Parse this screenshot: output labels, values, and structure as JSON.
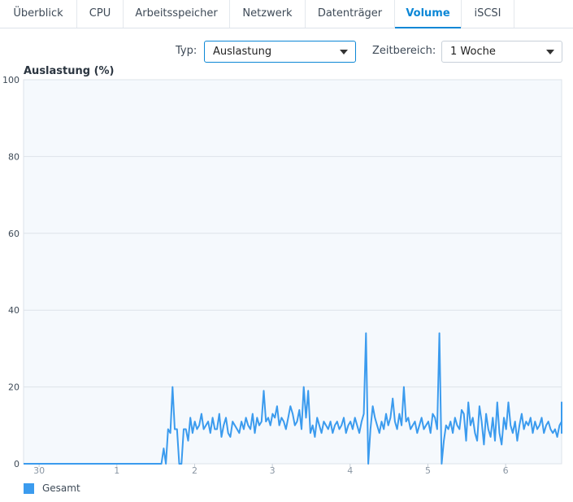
{
  "tabs": [
    {
      "label": "Überblick",
      "active": false
    },
    {
      "label": "CPU",
      "active": false
    },
    {
      "label": "Arbeitsspeicher",
      "active": false
    },
    {
      "label": "Netzwerk",
      "active": false
    },
    {
      "label": "Datenträger",
      "active": false
    },
    {
      "label": "Volume",
      "active": true
    },
    {
      "label": "iSCSI",
      "active": false
    }
  ],
  "filters": {
    "type_label": "Typ:",
    "type_value": "Auslastung",
    "range_label": "Zeitbereich:",
    "range_value": "1 Woche"
  },
  "colors": {
    "accent": "#0c87d6",
    "series": "#3b9bee",
    "plot_bg": "#f5f9fd"
  },
  "chart_data": {
    "type": "line",
    "title": "Auslastung (%)",
    "ylim": [
      0,
      100
    ],
    "yticks": [
      0,
      20,
      40,
      60,
      80,
      100
    ],
    "xlim": [
      29.8,
      6.72
    ],
    "xticks": [
      "30",
      "1",
      "2",
      "3",
      "4",
      "5",
      "6"
    ],
    "grid": true,
    "legend": "bottom-left",
    "series": [
      {
        "name": "Gesamt",
        "x_start": 29.8,
        "x_step": 0.0286,
        "values": [
          0,
          0,
          0,
          0,
          0,
          0,
          0,
          0,
          0,
          0,
          0,
          0,
          0,
          0,
          0,
          0,
          0,
          0,
          0,
          0,
          0,
          0,
          0,
          0,
          0,
          0,
          0,
          0,
          0,
          0,
          0,
          0,
          0,
          0,
          0,
          0,
          0,
          0,
          0,
          0,
          0,
          0,
          0,
          0,
          0,
          0,
          0,
          0,
          0,
          0,
          0,
          0,
          0,
          0,
          0,
          0,
          0,
          0,
          0,
          0,
          0,
          0,
          0,
          4,
          0,
          9,
          8,
          20,
          9,
          9,
          0,
          0,
          9,
          9,
          6,
          12,
          8,
          11,
          9,
          10,
          13,
          9,
          10,
          11,
          8,
          12,
          9,
          9,
          13,
          7,
          10,
          12,
          8,
          7,
          11,
          10,
          9,
          8,
          11,
          9,
          12,
          10,
          9,
          13,
          8,
          12,
          10,
          11,
          19,
          11,
          12,
          10,
          13,
          12,
          15,
          10,
          12,
          11,
          9,
          12,
          15,
          13,
          10,
          11,
          14,
          9,
          20,
          12,
          19,
          8,
          10,
          7,
          12,
          10,
          8,
          11,
          10,
          9,
          11,
          8,
          10,
          11,
          9,
          10,
          12,
          8,
          10,
          11,
          9,
          12,
          10,
          8,
          11,
          13,
          34,
          0,
          9,
          15,
          12,
          10,
          8,
          11,
          9,
          13,
          10,
          12,
          17,
          11,
          9,
          13,
          10,
          20,
          11,
          12,
          9,
          10,
          11,
          8,
          10,
          12,
          9,
          10,
          11,
          8,
          13,
          12,
          9,
          34,
          0,
          6,
          10,
          9,
          11,
          8,
          12,
          10,
          9,
          14,
          13,
          6,
          16,
          10,
          12,
          8,
          6,
          15,
          11,
          5,
          13,
          9,
          7,
          12,
          6,
          16,
          8,
          5,
          12,
          9,
          16,
          10,
          8,
          11,
          6,
          10,
          13,
          9,
          11,
          10,
          12,
          8,
          11,
          9,
          10,
          12,
          8,
          10,
          11,
          9,
          8,
          9,
          7,
          10,
          11,
          9,
          12,
          10,
          8,
          11,
          9,
          10,
          12,
          16,
          8,
          12,
          11,
          13
        ]
      }
    ]
  }
}
